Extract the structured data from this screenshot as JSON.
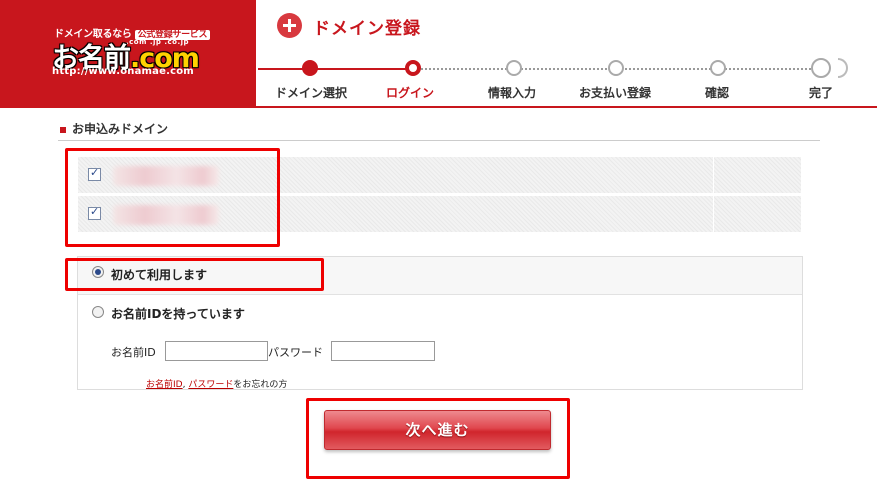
{
  "header": {
    "logo_tagline": "ドメイン取るなら",
    "logo_tagline_pill": "公式登録サービス",
    "logo_domains": ".com .jp .co.jp",
    "logo_name": "お名前",
    "logo_suffix": ".com",
    "logo_url": "http://www.onamae.com",
    "page_title": "ドメイン登録"
  },
  "steps": [
    {
      "label": "ドメイン選択",
      "state": "done"
    },
    {
      "label": "ログイン",
      "state": "current"
    },
    {
      "label": "情報入力",
      "state": "upcoming"
    },
    {
      "label": "お支払い登録",
      "state": "upcoming"
    },
    {
      "label": "確認",
      "state": "upcoming"
    },
    {
      "label": "完了",
      "state": "upcoming"
    }
  ],
  "section": {
    "heading": "お申込みドメイン",
    "domains": [
      {
        "name": "",
        "checked": true
      },
      {
        "name": "",
        "checked": true
      }
    ]
  },
  "login": {
    "option_new": "初めて利用します",
    "option_existing": "お名前IDを持っています",
    "selected": "new",
    "id_label": "お名前ID",
    "password_label": "パスワード",
    "id_value": "",
    "password_value": "",
    "forgot_id_link": "お名前ID",
    "forgot_sep": ",",
    "forgot_password_link": "パスワード",
    "forgot_suffix": "をお忘れの方"
  },
  "actions": {
    "next_label": "次へ進む"
  },
  "colors": {
    "brand_red": "#c8161d",
    "highlight": "#ee0000",
    "radio_accent": "#2c4a8a"
  }
}
